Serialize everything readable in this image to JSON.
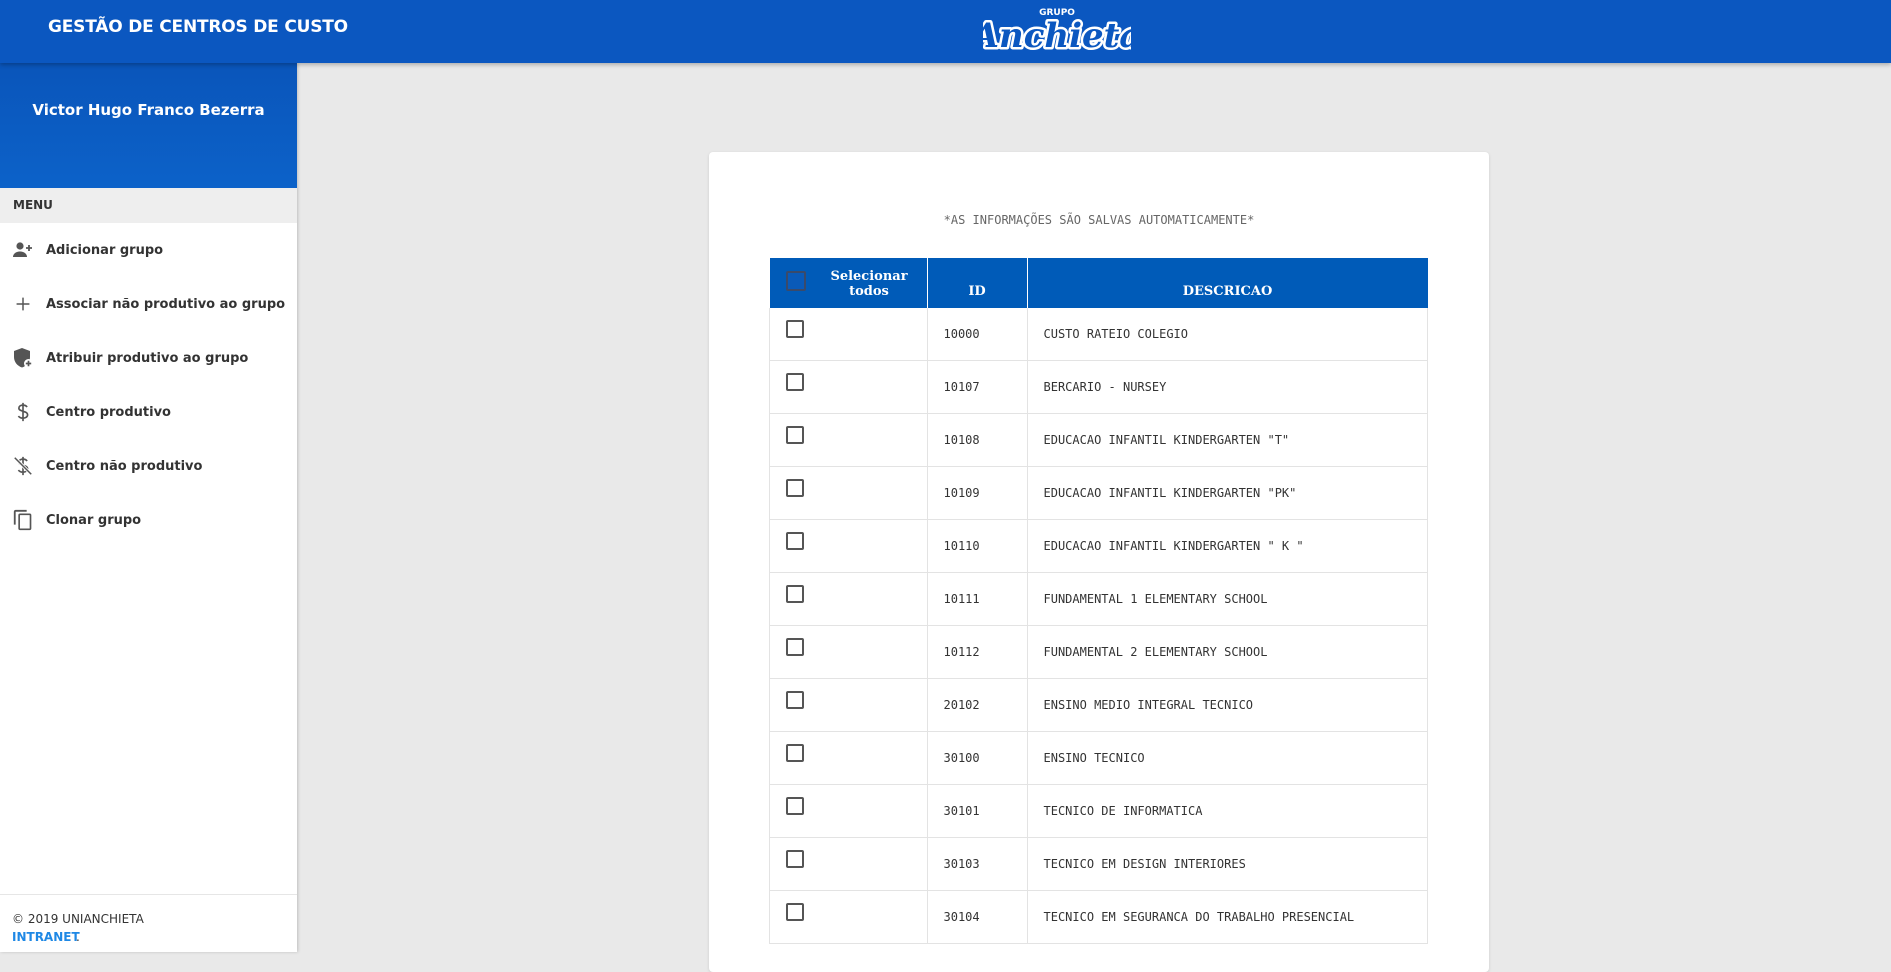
{
  "header": {
    "title": "GESTÃO DE CENTROS DE CUSTO",
    "logo_small": "GRUPO",
    "logo_main": "Anchieta",
    "background": "#0b57c0"
  },
  "sidebar": {
    "user_name": "Victor Hugo Franco Bezerra",
    "menu_title": "MENU",
    "items": [
      {
        "label": "Adicionar grupo",
        "icon": "add-user-icon"
      },
      {
        "label": "Associar não produtivo ao grupo",
        "icon": "plus-icon"
      },
      {
        "label": "Atribuir produtivo ao grupo",
        "icon": "shield-add-icon"
      },
      {
        "label": "Centro produtivo",
        "icon": "dollar-icon"
      },
      {
        "label": "Centro não produtivo",
        "icon": "dollar-off-icon"
      },
      {
        "label": "Clonar grupo",
        "icon": "copy-icon"
      }
    ],
    "footer": {
      "copyright": "© 2019 UNIANCHIETA",
      "link": "INTRANET",
      "dot": "."
    }
  },
  "main": {
    "notice": "*AS INFORMAÇÕES SÃO SALVAS AUTOMATICAMENTE*",
    "table": {
      "select_all_label": "Selecionar todos",
      "columns": [
        "ID",
        "DESCRICAO"
      ],
      "rows": [
        {
          "id": "10000",
          "descricao": "CUSTO RATEIO COLEGIO"
        },
        {
          "id": "10107",
          "descricao": "BERCARIO - NURSEY"
        },
        {
          "id": "10108",
          "descricao": "EDUCACAO INFANTIL KINDERGARTEN \"T\""
        },
        {
          "id": "10109",
          "descricao": "EDUCACAO INFANTIL KINDERGARTEN \"PK\""
        },
        {
          "id": "10110",
          "descricao": "EDUCACAO INFANTIL KINDERGARTEN \" K \""
        },
        {
          "id": "10111",
          "descricao": "FUNDAMENTAL 1 ELEMENTARY SCHOOL"
        },
        {
          "id": "10112",
          "descricao": "FUNDAMENTAL 2 ELEMENTARY SCHOOL"
        },
        {
          "id": "20102",
          "descricao": "ENSINO MEDIO INTEGRAL TECNICO"
        },
        {
          "id": "30100",
          "descricao": "ENSINO TECNICO"
        },
        {
          "id": "30101",
          "descricao": "TECNICO DE INFORMATICA"
        },
        {
          "id": "30103",
          "descricao": "TECNICO EM DESIGN INTERIORES"
        },
        {
          "id": "30104",
          "descricao": "TECNICO EM SEGURANCA DO TRABALHO PRESENCIAL"
        }
      ]
    }
  }
}
